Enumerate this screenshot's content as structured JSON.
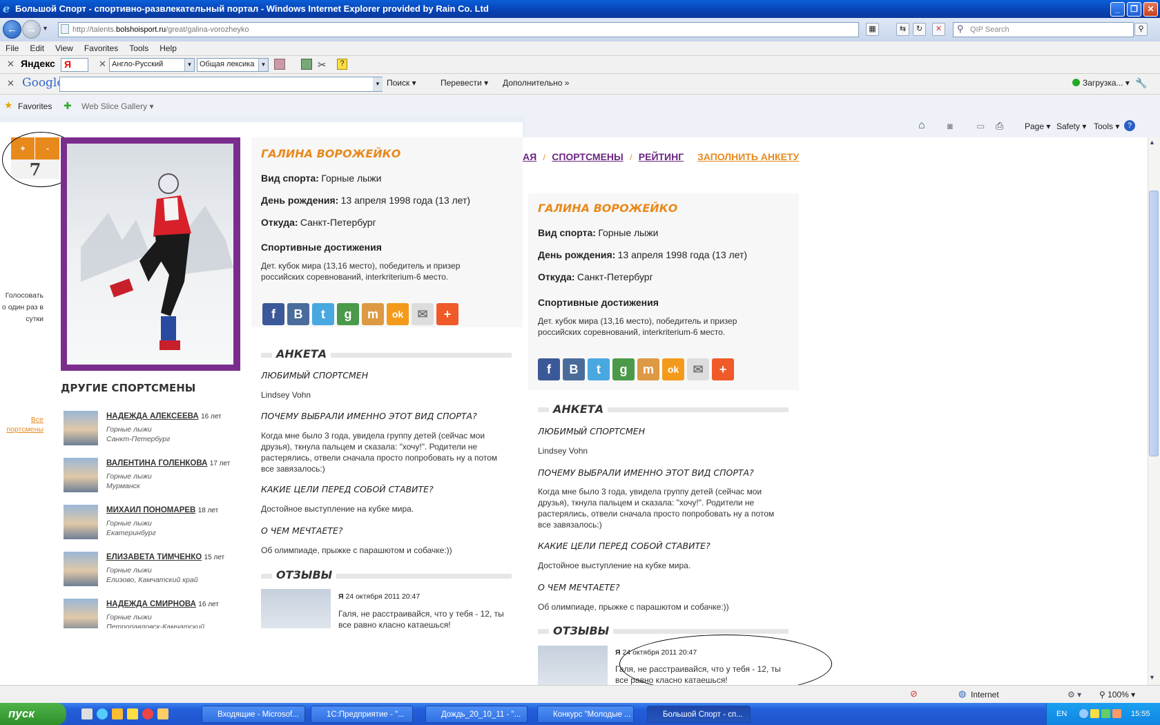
{
  "window": {
    "title": "Большой Спорт - спортивно-развлекательный портал - Windows Internet Explorer provided by Rain Co. Ltd",
    "btn_min": "_",
    "btn_max": "❐",
    "btn_close": "✕"
  },
  "address": {
    "prefix": "http://talents.",
    "domain": "bolshoisport.ru",
    "path": "/great/galina-vorozheyko",
    "search_placeholder": "QIP Search"
  },
  "menu": [
    "File",
    "Edit",
    "View",
    "Favorites",
    "Tools",
    "Help"
  ],
  "yandex": {
    "brand": "Яндекс",
    "lang_select": "Англо-Русский",
    "dict_select": "Общая лексика"
  },
  "google": {
    "brand": "Google",
    "search_label": "Поиск",
    "translate_label": "Перевести",
    "more_label": "Дополнительно",
    "loading_label": "Загрузка..."
  },
  "favorites": {
    "label": "Favorites",
    "web_slice": "Web Slice Gallery"
  },
  "command": {
    "page": "Page",
    "safety": "Safety",
    "tools": "Tools"
  },
  "vote": {
    "plus": "+",
    "minus": "-",
    "count": "7",
    "note_1": "Голосовать",
    "note_2": "о один раз в",
    "note_3": "сутки"
  },
  "profile": {
    "name": "ГАЛИНА ВОРОЖЕЙКО",
    "sport_label": "Вид спорта:",
    "sport": "Горные лыжи",
    "birthday_label": "День рождения:",
    "birthday": "13 апреля 1998 года (13 лет)",
    "from_label": "Откуда:",
    "from": "Санкт-Петербург",
    "achievements_title": "Спортивные достижения",
    "achievements_1": "Дет. кубок мира (13,16 место), победитель и призер",
    "achievements_2": "российских соревнований, interkriterium-6 место."
  },
  "social": [
    "f",
    "B",
    "t",
    "g",
    "m",
    "ok",
    "✉",
    "+"
  ],
  "anketa": {
    "title": "АНКЕТА",
    "q1": "ЛЮБИМЫЙ СПОРТСМЕН",
    "a1": "Lindsey Vohn",
    "q2": "ПОЧЕМУ ВЫБРАЛИ ИМЕННО ЭТОТ ВИД СПОРТА?",
    "a2_1": "Когда мне было 3 года, увидела группу детей (сейчас мои",
    "a2_2": "друзья), ткнула пальцем и сказала: \"хочу!\". Родители не",
    "a2_3": "растерялись, отвели сначала просто попробовать ну а потом",
    "a2_4": "все завязалось:)",
    "q3": "КАКИЕ ЦЕЛИ ПЕРЕД СОБОЙ СТАВИТЕ?",
    "a3": "Достойное выступление на кубке мира.",
    "q4": "О ЧЕМ МЕЧТАЕТЕ?",
    "a4": "Об олимпиаде, прыжке с парашютом и собачке:))"
  },
  "reviews": {
    "title": "ОТЗЫВЫ",
    "author": "Я",
    "date": "24 октября 2011 20:47",
    "text_1": "Галя, не расстраивайся, что у тебя - 12, ты",
    "text_2": "все равно класно катаешься!"
  },
  "others": {
    "title": "ДРУГИЕ СПОРТСМЕНЫ",
    "all_1": "Все",
    "all_2": "портсмены",
    "items": [
      {
        "name": "НАДЕЖДА АЛЕКСЕЕВА",
        "age": "16 лет",
        "sport": "Горные лыжи",
        "city": "Санкт-Петербург"
      },
      {
        "name": "ВАЛЕНТИНА ГОЛЕНКОВА",
        "age": "17 лет",
        "sport": "Горные лыжи",
        "city": "Мурманск"
      },
      {
        "name": "МИХАИЛ ПОНОМАРЕВ",
        "age": "18 лет",
        "sport": "Горные лыжи",
        "city": "Екатеринбург"
      },
      {
        "name": "ЕЛИЗАВЕТА ТИМЧЕНКО",
        "age": "15 лет",
        "sport": "Горные лыжи",
        "city": "Елизово, Камчатский край"
      },
      {
        "name": "НАДЕЖДА СМИРНОВА",
        "age": "16 лет",
        "sport": "Горные лыжи",
        "city": "Петропавловск-Камчатский"
      }
    ]
  },
  "nav": {
    "partial": "АЯ",
    "athletes": "СПОРТСМЕНЫ",
    "rating": "РЕЙТИНГ",
    "fill": "ЗАПОЛНИТЬ АНКЕТУ",
    "sep": "/"
  },
  "status": {
    "zone": "Internet",
    "zoom": "100%"
  },
  "taskbar": {
    "start": "пуск",
    "tasks": [
      "Входящие - Microsof...",
      "1С:Предприятие - \"...",
      "Дождь_20_10_11 - \"...",
      "Конкурс \"Молодые ...",
      "Большой Спорт - сп..."
    ],
    "lang": "EN",
    "clock": "15:55"
  },
  "colors": {
    "accent": "#e8891c",
    "brand": "#7b2d8e"
  }
}
